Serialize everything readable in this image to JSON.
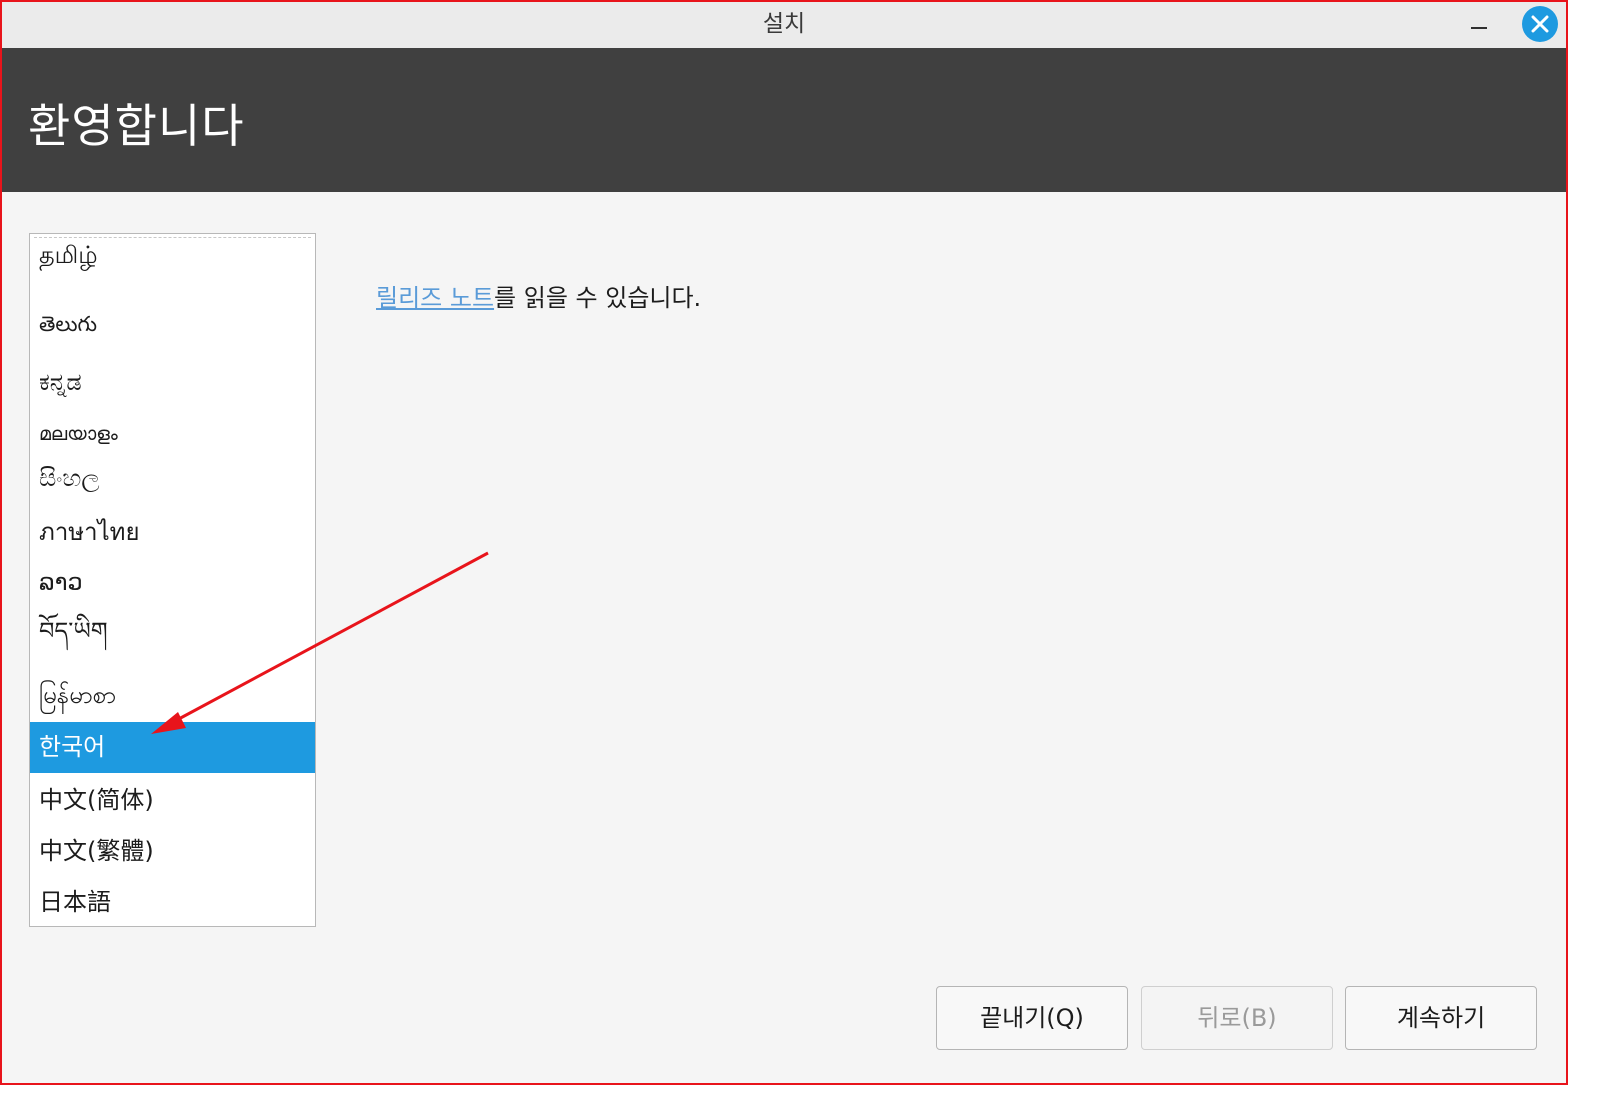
{
  "window": {
    "title": "설치"
  },
  "header": {
    "title": "환영합니다"
  },
  "languages": [
    {
      "label": "தமிழ்"
    },
    {
      "label": "తెలుగు"
    },
    {
      "label": "ಕನ್ನಡ"
    },
    {
      "label": "മലയാളം"
    },
    {
      "label": "සිංහල"
    },
    {
      "label": "ภาษาไทย"
    },
    {
      "label": "ລາວ"
    },
    {
      "label": "བོད་ཡིག"
    },
    {
      "label": "မြန်မာစာ"
    },
    {
      "label": "한국어",
      "selected": true
    },
    {
      "label": "中文(简体)"
    },
    {
      "label": "中文(繁體)"
    },
    {
      "label": "日本語"
    }
  ],
  "content": {
    "release_link": "릴리즈 노트",
    "release_rest": "를 읽을 수 있습니다."
  },
  "buttons": {
    "quit": "끝내기(Q)",
    "back": "뒤로(B)",
    "continue": "계속하기"
  },
  "colors": {
    "selection": "#1e9ae0",
    "header_bg": "#404040",
    "link": "#5a9bd8",
    "annotation_arrow": "#e8141b"
  },
  "icons": {
    "close": "close-icon",
    "minimize": "minimize-icon"
  }
}
